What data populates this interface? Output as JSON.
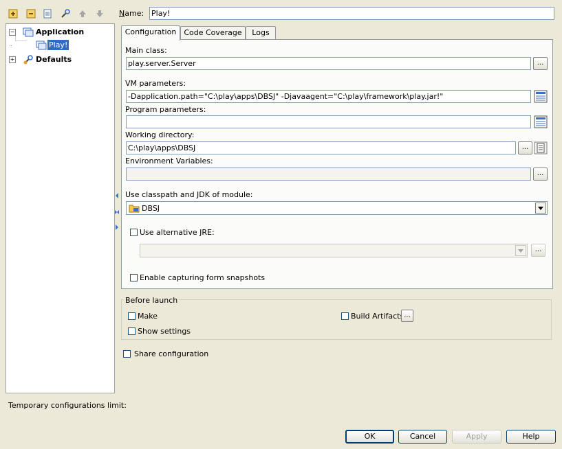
{
  "toolbar": {
    "buttons": [
      "add-icon",
      "remove-icon",
      "copy-icon",
      "wrench-icon",
      "up-arrow-icon",
      "down-arrow-icon"
    ]
  },
  "tree": {
    "items": [
      {
        "label": "Application",
        "expander": "−"
      },
      {
        "label": "Play!"
      },
      {
        "label": "Defaults",
        "expander": "+"
      }
    ]
  },
  "name_label": "Name:",
  "name_value": "Play!",
  "tabs": [
    "Configuration",
    "Code Coverage",
    "Logs"
  ],
  "form": {
    "main_class_label": "Main class:",
    "main_class_value": "play.server.Server",
    "vm_params_label": "VM parameters:",
    "vm_params_value": "-Dapplication.path=\"C:\\play\\apps\\DBSJ\" -Djavaagent=\"C:\\play\\framework\\play.jar!\"",
    "program_params_label": "Program parameters:",
    "program_params_value": "",
    "working_dir_label": "Working directory:",
    "working_dir_value": "C:\\play\\apps\\DBSJ",
    "env_vars_label": "Environment Variables:",
    "env_vars_value": "",
    "module_label": "Use classpath and JDK of module:",
    "module_value": "DBSJ",
    "alt_jre_label": "Use alternative JRE:",
    "alt_jre_value": "",
    "snapshots_label": "Enable capturing form snapshots",
    "dots": "..."
  },
  "before_launch": {
    "title": "Before launch",
    "make": "Make",
    "build_artifacts": "Build Artifacts",
    "show_settings": "Show settings"
  },
  "share_label": "Share configuration",
  "temp_limit_label": "Temporary configurations limit:",
  "buttons": {
    "ok": "OK",
    "cancel": "Cancel",
    "apply": "Apply",
    "help": "Help"
  },
  "colors": {
    "background": "#ece9d8",
    "selection": "#316ac5",
    "border": "#7f9db9"
  }
}
